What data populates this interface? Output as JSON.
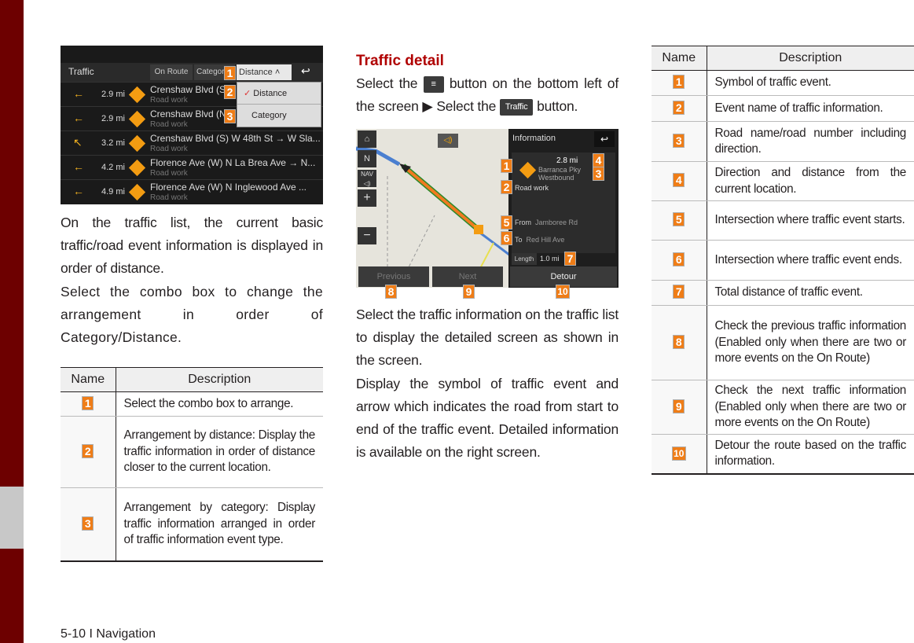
{
  "footer": "5-10 I Navigation",
  "left": {
    "screen": {
      "title": "Traffic",
      "tabs": [
        "On Route",
        "Category",
        "Distance"
      ],
      "dropdown": [
        "Distance",
        "Category"
      ],
      "rows": [
        {
          "dist": "2.9 mi",
          "road": "Crenshaw Blvd (S",
          "type": "Road work",
          "dir": "left"
        },
        {
          "dist": "2.9 mi",
          "road": "Crenshaw Blvd (N",
          "type": "Road work",
          "dir": "left"
        },
        {
          "dist": "3.2 mi",
          "road": "Crenshaw Blvd (S) W 48th St → W Sla...",
          "type": "Road work",
          "dir": "up-left"
        },
        {
          "dist": "4.2 mi",
          "road": "Florence Ave (W) N La Brea Ave → N...",
          "type": "Road work",
          "dir": "left"
        },
        {
          "dist": "4.9 mi",
          "road": "Florence Ave (W) N Inglewood Ave ...",
          "type": "Road work",
          "dir": "left"
        }
      ],
      "badges": [
        "1",
        "2",
        "3"
      ]
    },
    "para1": "On the traffic list, the current basic traffic/road event information is displayed in order of distance.",
    "para2": "Select the combo box to change the arrangement in order of Category/Distance.",
    "table": {
      "headers": [
        "Name",
        "Description"
      ],
      "rows": [
        {
          "n": "1",
          "d": "Select the combo box to arrange."
        },
        {
          "n": "2",
          "d": "Arrangement by distance: Display the traffic information in order of distance closer to the current location."
        },
        {
          "n": "3",
          "d": "Arrangement by category: Display traffic information arranged in order of traffic information event type."
        }
      ]
    }
  },
  "middle": {
    "heading": "Traffic detail",
    "instr_a": "Select the",
    "instr_b": "button on the bottom left of the screen",
    "instr_c": "Select the",
    "traffic_btn": "Traffic",
    "instr_d": "button.",
    "screen": {
      "title": "Information",
      "distance": "2.8 mi",
      "road": "Barranca Pky",
      "road2": "Westbound",
      "event": "Road work",
      "from_label": "From",
      "from": "Jamboree Rd",
      "to_label": "To",
      "to": "Red Hill Ave",
      "length_label": "Length",
      "length": "1.0 mi",
      "prev": "Previous",
      "next": "Next",
      "detour": "Detour",
      "map_ctrls": [
        "N",
        "NAV"
      ],
      "badges": [
        "1",
        "2",
        "3",
        "4",
        "5",
        "6",
        "7",
        "8",
        "9",
        "10"
      ]
    },
    "para1": "Select the traffic information on the traffic list to display the detailed screen as shown in the screen.",
    "para2": "Display the symbol of traffic event and arrow which indicates the road from start to end of the traffic event. Detailed information is available on the right screen."
  },
  "right": {
    "table": {
      "headers": [
        "Name",
        "Description"
      ],
      "rows": [
        {
          "n": "1",
          "d": "Symbol of traffic event."
        },
        {
          "n": "2",
          "d": "Event name of traffic information."
        },
        {
          "n": "3",
          "d": "Road name/road number including direction."
        },
        {
          "n": "4",
          "d": "Direction and distance from the current location."
        },
        {
          "n": "5",
          "d": "Intersection where traffic event starts."
        },
        {
          "n": "6",
          "d": "Intersection where traffic event ends."
        },
        {
          "n": "7",
          "d": "Total distance of traffic event."
        },
        {
          "n": "8",
          "d": "Check the previous traffic information (Enabled only when there are two or more events on the On Route)"
        },
        {
          "n": "9",
          "d": "Check the next traffic information (Enabled only when there are two or more events on the On Route)"
        },
        {
          "n": "10",
          "d": "Detour the route based on the traffic information."
        }
      ]
    }
  },
  "colors": {
    "accent": "#6d0000",
    "heading": "#b00000",
    "badge": "#ef7d17"
  }
}
